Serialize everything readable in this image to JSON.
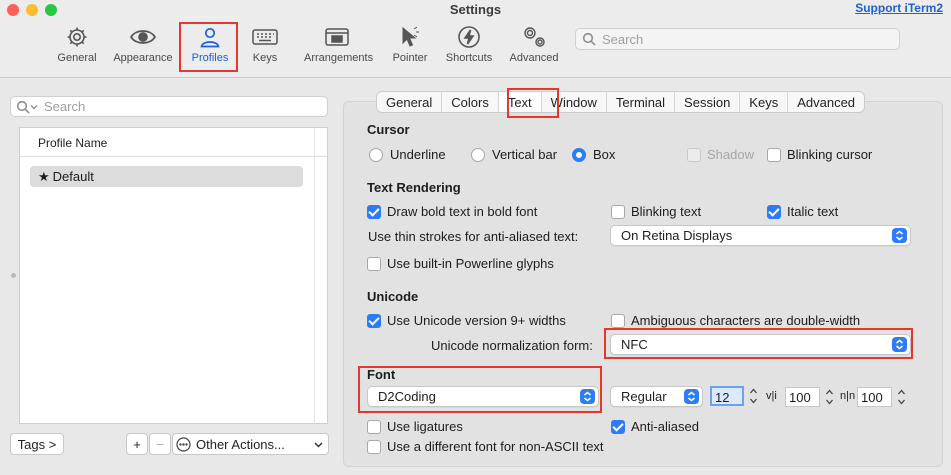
{
  "window": {
    "title": "Settings",
    "support_link": "Support iTerm2"
  },
  "toolbar": {
    "items": [
      {
        "label": "General",
        "icon": "gear-icon"
      },
      {
        "label": "Appearance",
        "icon": "eye-icon"
      },
      {
        "label": "Profiles",
        "icon": "person-icon",
        "active": true
      },
      {
        "label": "Keys",
        "icon": "keyboard-icon"
      },
      {
        "label": "Arrangements",
        "icon": "window-stack-icon"
      },
      {
        "label": "Pointer",
        "icon": "pointer-icon"
      },
      {
        "label": "Shortcuts",
        "icon": "bolt-icon"
      },
      {
        "label": "Advanced",
        "icon": "gears-icon"
      }
    ],
    "search_placeholder": "Search"
  },
  "sidebar": {
    "search_placeholder": "Search",
    "column_header": "Profile Name",
    "profiles": [
      {
        "name": "Default",
        "default": true
      }
    ],
    "tags_button": "Tags >",
    "add_button": "+",
    "remove_button": "−",
    "other_actions": "Other Actions..."
  },
  "tabs": [
    "General",
    "Colors",
    "Text",
    "Window",
    "Terminal",
    "Session",
    "Keys",
    "Advanced"
  ],
  "selected_tab": "Text",
  "cursor": {
    "title": "Cursor",
    "underline": "Underline",
    "vertical_bar": "Vertical bar",
    "box": "Box",
    "selected": "Box",
    "shadow": "Shadow",
    "blinking_cursor": "Blinking cursor",
    "shadow_checked": false,
    "blinking_checked": false
  },
  "text_rendering": {
    "title": "Text Rendering",
    "bold": "Draw bold text in bold font",
    "bold_checked": true,
    "blinking_text": "Blinking text",
    "blinking_text_checked": false,
    "italic": "Italic text",
    "italic_checked": true,
    "thin_strokes_label": "Use thin strokes for anti-aliased text:",
    "thin_strokes_value": "On Retina Displays",
    "powerline": "Use built-in Powerline glyphs",
    "powerline_checked": false
  },
  "unicode": {
    "title": "Unicode",
    "version9": "Use Unicode version 9+ widths",
    "version9_checked": true,
    "ambiguous": "Ambiguous characters are double-width",
    "ambiguous_checked": false,
    "normalization_label": "Unicode normalization form:",
    "normalization_value": "NFC"
  },
  "font": {
    "title": "Font",
    "family": "D2Coding",
    "weight": "Regular",
    "size": "12",
    "vertical_spacing_icon": "v|i",
    "vertical_spacing": "100",
    "horizontal_spacing_icon": "n|n",
    "horizontal_spacing": "100",
    "ligatures": "Use ligatures",
    "ligatures_checked": false,
    "anti_aliased": "Anti-aliased",
    "anti_aliased_checked": true,
    "non_ascii": "Use a different font for non-ASCII text",
    "non_ascii_checked": false
  },
  "colors": {
    "accent": "#2b7cf6",
    "highlight": "#e4392a",
    "link": "#1a62d6"
  }
}
